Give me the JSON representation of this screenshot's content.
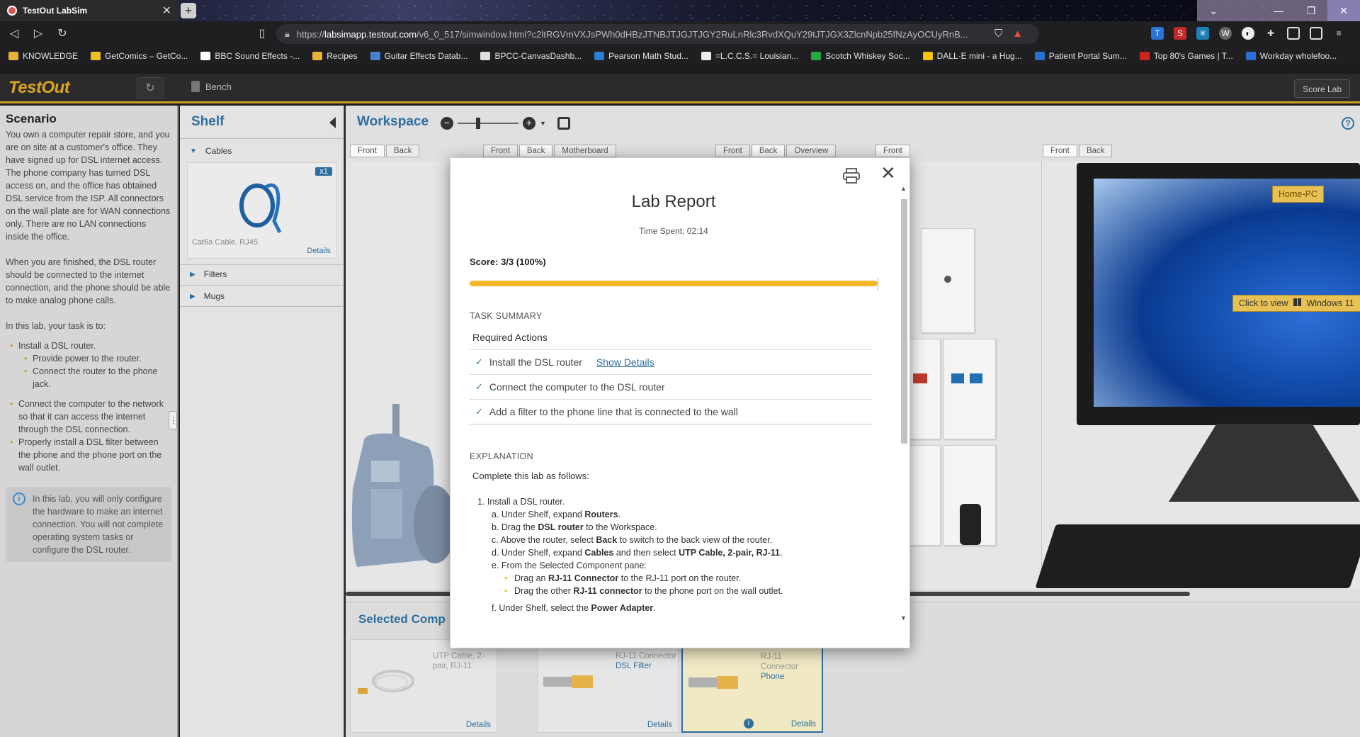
{
  "browser": {
    "tab_title": "TestOut LabSim",
    "url_prefix": "https://",
    "url_host": "labsimapp.testout.com",
    "url_path": "/v6_0_517/simwindow.html?c2ltRGVmVXJsPWh0dHBzJTNBJTJGJTJGY2RuLnRlc3RvdXQuY29tJTJGX3ZlcnNpb25fNzAyOCUyRnB..."
  },
  "bookmarks": [
    {
      "label": "KNOWLEDGE",
      "color": "#e8b23a"
    },
    {
      "label": "GetComics – GetCo...",
      "color": "#f0c020"
    },
    {
      "label": "BBC Sound Effects -...",
      "color": "#ffffff"
    },
    {
      "label": "Recipes",
      "color": "#e8b23a"
    },
    {
      "label": "Guitar Effects Datab...",
      "color": "#4a7fd0"
    },
    {
      "label": "BPCC-CanvasDashb...",
      "color": "#e0e0e0"
    },
    {
      "label": "Pearson Math Stud...",
      "color": "#2a7fd6"
    },
    {
      "label": "=L.C.C.S.= Louisian...",
      "color": "#eeeeee"
    },
    {
      "label": "Scotch Whiskey Soc...",
      "color": "#22aa44"
    },
    {
      "label": "DALL·E mini - a Hug...",
      "color": "#f5c400"
    },
    {
      "label": "Patient Portal Sum...",
      "color": "#2a6fd6"
    },
    {
      "label": "Top 80's Games | T...",
      "color": "#cc2222"
    },
    {
      "label": "Workday wholefoo...",
      "color": "#2a6fd6"
    }
  ],
  "app": {
    "logo": "TestOut",
    "bench_label": "Bench",
    "score_lab_label": "Score Lab"
  },
  "scenario": {
    "title": "Scenario",
    "para1": "You own a computer repair store, and you are on site at a customer's office. They have signed up for DSL internet access. The phone company has turned DSL access on, and the office has obtained DSL service from the ISP. All connectors on the wall plate are for WAN connections only. There are no LAN connections inside the office.",
    "para2": "When you are finished, the DSL router should be connected to the internet connection, and the phone should be able to make analog phone calls.",
    "para3": "In this lab, your task is to:",
    "tasks": [
      "Install a DSL router.",
      "Provide power to the router.",
      "Connect the router to the phone jack.",
      "Connect the computer to the network so that it can access the internet through the DSL connection.",
      "Properly install a DSL filter between the phone and the phone port on the wall outlet."
    ],
    "note": "In this lab, you will only configure the hardware to make an internet connection. You will not complete operating system tasks or configure the DSL router."
  },
  "shelf": {
    "title": "Shelf",
    "groups": [
      "Cables",
      "Filters",
      "Mugs"
    ],
    "cable_item": {
      "name": "Cat6a Cable, RJ45",
      "count": "x1",
      "details": "Details"
    }
  },
  "workspace": {
    "title": "Workspace",
    "view_tabs": {
      "a": [
        "Front",
        "Back"
      ],
      "b": [
        "Front",
        "Back",
        "Motherboard"
      ],
      "c": [
        "Front",
        "Back",
        "Overview"
      ],
      "d": [
        "Front"
      ],
      "e": [
        "Front",
        "Back"
      ]
    },
    "home_pc": "Home-PC",
    "click_to_view": "Click to view",
    "windows_label": "Windows 11",
    "selected_components_title": "Selected Comp",
    "components": [
      {
        "label": "UTP Cable, 2-pair, RJ-11",
        "sub": "",
        "details": "Details"
      },
      {
        "label": "RJ-11 Connector",
        "sub": "DSL Filter",
        "details": "Details"
      },
      {
        "label": "RJ-11 Connector",
        "sub": "Phone",
        "details": "Details"
      }
    ]
  },
  "report": {
    "title": "Lab Report",
    "time_spent": "Time Spent: 02:14",
    "score": "Score: 3/3 (100%)",
    "score_fraction": 1.0,
    "task_summary_heading": "TASK SUMMARY",
    "required_actions": "Required Actions",
    "tasks": [
      {
        "label": "Install the DSL router",
        "link": "Show Details"
      },
      {
        "label": "Connect the computer to the DSL router",
        "link": ""
      },
      {
        "label": "Add a filter to the phone line that is connected to the wall",
        "link": ""
      }
    ],
    "explanation_heading": "EXPLANATION",
    "explanation_intro": "Complete this lab as follows:",
    "steps": [
      {
        "kind": "top",
        "text": "1. Install a DSL router."
      },
      {
        "kind": "sub",
        "html": "a. Under Shelf, expand <b>Routers</b>."
      },
      {
        "kind": "sub",
        "html": "b. Drag the <b>DSL router</b> to the Workspace."
      },
      {
        "kind": "sub",
        "html": "c. Above the router, select <b>Back</b> to switch to the back view of the router."
      },
      {
        "kind": "sub",
        "html": "d. Under Shelf, expand <b>Cables</b> and then select <b>UTP Cable, 2-pair, RJ-11</b>."
      },
      {
        "kind": "sub",
        "html": "e. From the Selected Component pane:"
      },
      {
        "kind": "bul",
        "html": "Drag an <b>RJ-11 Connector</b> to the RJ-11 port on the router."
      },
      {
        "kind": "bul",
        "html": "Drag the other <b>RJ-11 connector</b> to the phone port on the wall outlet."
      },
      {
        "kind": "sub",
        "html": "f. Under Shelf, select the <b>Power Adapter</b>."
      }
    ]
  }
}
